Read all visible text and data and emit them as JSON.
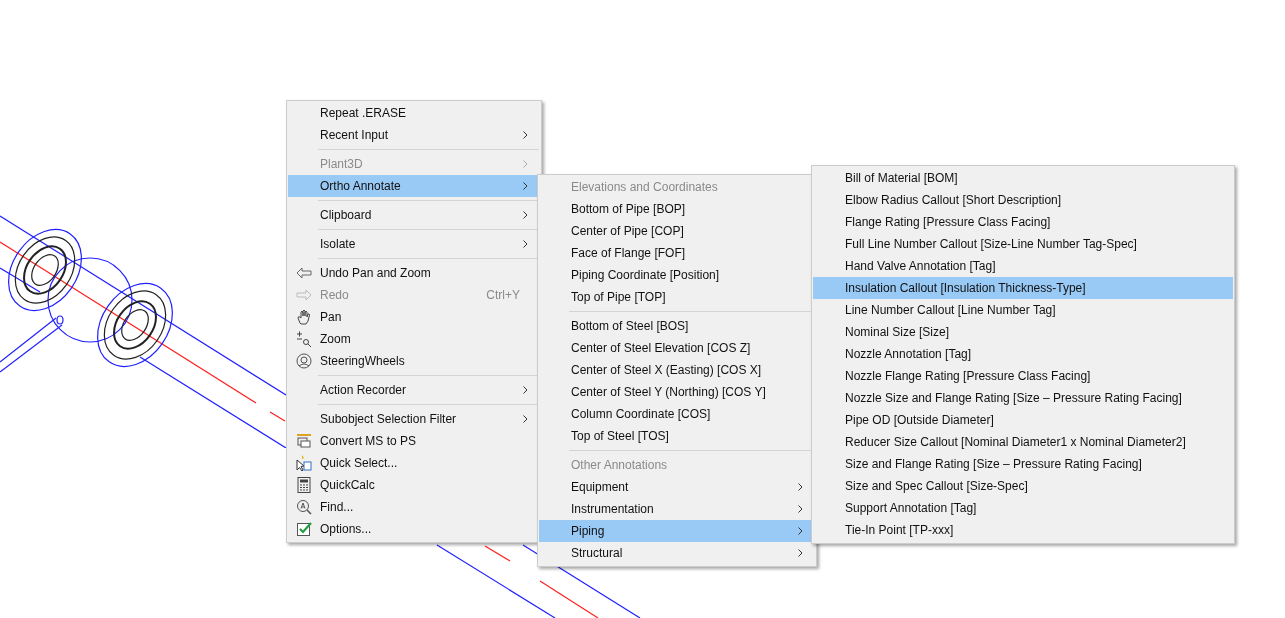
{
  "menus": [
    {
      "items": [
        {
          "kind": "item",
          "label": "Repeat .ERASE",
          "disabled": false,
          "selected": false,
          "submenu": false
        },
        {
          "kind": "item",
          "label": "Recent Input",
          "disabled": false,
          "selected": false,
          "submenu": true
        },
        {
          "kind": "separator"
        },
        {
          "kind": "item",
          "label": "Plant3D",
          "disabled": true,
          "selected": false,
          "submenu": true
        },
        {
          "kind": "item",
          "label": "Ortho Annotate",
          "disabled": false,
          "selected": true,
          "submenu": true
        },
        {
          "kind": "separator"
        },
        {
          "kind": "item",
          "label": "Clipboard",
          "disabled": false,
          "selected": false,
          "submenu": true
        },
        {
          "kind": "separator"
        },
        {
          "kind": "item",
          "label": "Isolate",
          "disabled": false,
          "selected": false,
          "submenu": true
        },
        {
          "kind": "separator"
        },
        {
          "kind": "item",
          "label": "Undo Pan and Zoom",
          "disabled": false,
          "selected": false,
          "submenu": false
        },
        {
          "kind": "item",
          "label": "Redo",
          "shortcut": "Ctrl+Y",
          "disabled": true,
          "selected": false,
          "submenu": false
        },
        {
          "kind": "item",
          "label": "Pan",
          "disabled": false,
          "selected": false,
          "submenu": false
        },
        {
          "kind": "item",
          "label": "Zoom",
          "disabled": false,
          "selected": false,
          "submenu": false
        },
        {
          "kind": "item",
          "label": "SteeringWheels",
          "disabled": false,
          "selected": false,
          "submenu": false
        },
        {
          "kind": "separator"
        },
        {
          "kind": "item",
          "label": "Action Recorder",
          "disabled": false,
          "selected": false,
          "submenu": true
        },
        {
          "kind": "separator"
        },
        {
          "kind": "item",
          "label": "Subobject Selection Filter",
          "disabled": false,
          "selected": false,
          "submenu": true
        },
        {
          "kind": "item",
          "label": "Convert MS to PS",
          "disabled": false,
          "selected": false,
          "submenu": false
        },
        {
          "kind": "item",
          "label": "Quick Select...",
          "disabled": false,
          "selected": false,
          "submenu": false
        },
        {
          "kind": "item",
          "label": "QuickCalc",
          "disabled": false,
          "selected": false,
          "submenu": false
        },
        {
          "kind": "item",
          "label": "Find...",
          "disabled": false,
          "selected": false,
          "submenu": false
        },
        {
          "kind": "item",
          "label": "Options...",
          "disabled": false,
          "selected": false,
          "submenu": false
        }
      ]
    },
    {
      "items": [
        {
          "kind": "header",
          "label": "Elevations and Coordinates"
        },
        {
          "kind": "item",
          "label": "Bottom of Pipe [BOP]",
          "selected": false,
          "submenu": false
        },
        {
          "kind": "item",
          "label": "Center of Pipe [COP]",
          "selected": false,
          "submenu": false
        },
        {
          "kind": "item",
          "label": "Face of Flange [FOF]",
          "selected": false,
          "submenu": false
        },
        {
          "kind": "item",
          "label": "Piping Coordinate [Position]",
          "selected": false,
          "submenu": false
        },
        {
          "kind": "item",
          "label": "Top of Pipe [TOP]",
          "selected": false,
          "submenu": false
        },
        {
          "kind": "separator"
        },
        {
          "kind": "item",
          "label": "Bottom of Steel [BOS]",
          "selected": false,
          "submenu": false
        },
        {
          "kind": "item",
          "label": "Center of Steel Elevation [COS Z]",
          "selected": false,
          "submenu": false
        },
        {
          "kind": "item",
          "label": "Center of Steel X (Easting) [COS X]",
          "selected": false,
          "submenu": false
        },
        {
          "kind": "item",
          "label": "Center of Steel Y (Northing) [COS Y]",
          "selected": false,
          "submenu": false
        },
        {
          "kind": "item",
          "label": "Column Coordinate [COS]",
          "selected": false,
          "submenu": false
        },
        {
          "kind": "item",
          "label": "Top of Steel [TOS]",
          "selected": false,
          "submenu": false
        },
        {
          "kind": "separator"
        },
        {
          "kind": "header",
          "label": "Other Annotations"
        },
        {
          "kind": "item",
          "label": "Equipment",
          "selected": false,
          "submenu": true
        },
        {
          "kind": "item",
          "label": "Instrumentation",
          "selected": false,
          "submenu": true
        },
        {
          "kind": "item",
          "label": "Piping",
          "selected": true,
          "submenu": true
        },
        {
          "kind": "item",
          "label": "Structural",
          "selected": false,
          "submenu": true
        }
      ]
    },
    {
      "items": [
        {
          "kind": "item",
          "label": "Bill of Material [BOM]",
          "selected": false
        },
        {
          "kind": "item",
          "label": "Elbow Radius Callout [Short Description]",
          "selected": false
        },
        {
          "kind": "item",
          "label": "Flange Rating [Pressure Class Facing]",
          "selected": false
        },
        {
          "kind": "item",
          "label": "Full Line Number Callout [Size-Line Number Tag-Spec]",
          "selected": false
        },
        {
          "kind": "item",
          "label": "Hand Valve Annotation [Tag]",
          "selected": false
        },
        {
          "kind": "item",
          "label": "Insulation Callout [Insulation Thickness-Type]",
          "selected": true
        },
        {
          "kind": "item",
          "label": "Line Number Callout [Line Number Tag]",
          "selected": false
        },
        {
          "kind": "item",
          "label": "Nominal Size [Size]",
          "selected": false
        },
        {
          "kind": "item",
          "label": "Nozzle Annotation [Tag]",
          "selected": false
        },
        {
          "kind": "item",
          "label": "Nozzle Flange Rating [Pressure Class Facing]",
          "selected": false
        },
        {
          "kind": "item",
          "label": "Nozzle Size and Flange Rating [Size – Pressure Rating Facing]",
          "selected": false
        },
        {
          "kind": "item",
          "label": "Pipe OD [Outside Diameter]",
          "selected": false
        },
        {
          "kind": "item",
          "label": "Reducer Size Callout [Nominal Diameter1 x Nominal Diameter2]",
          "selected": false
        },
        {
          "kind": "item",
          "label": "Size and Flange Rating [Size – Pressure Rating Facing]",
          "selected": false
        },
        {
          "kind": "item",
          "label": "Size and Spec Callout [Size-Spec]",
          "selected": false
        },
        {
          "kind": "item",
          "label": "Support Annotation [Tag]",
          "selected": false
        },
        {
          "kind": "item",
          "label": "Tie-In Point [TP-xxx]",
          "selected": false
        }
      ]
    }
  ]
}
